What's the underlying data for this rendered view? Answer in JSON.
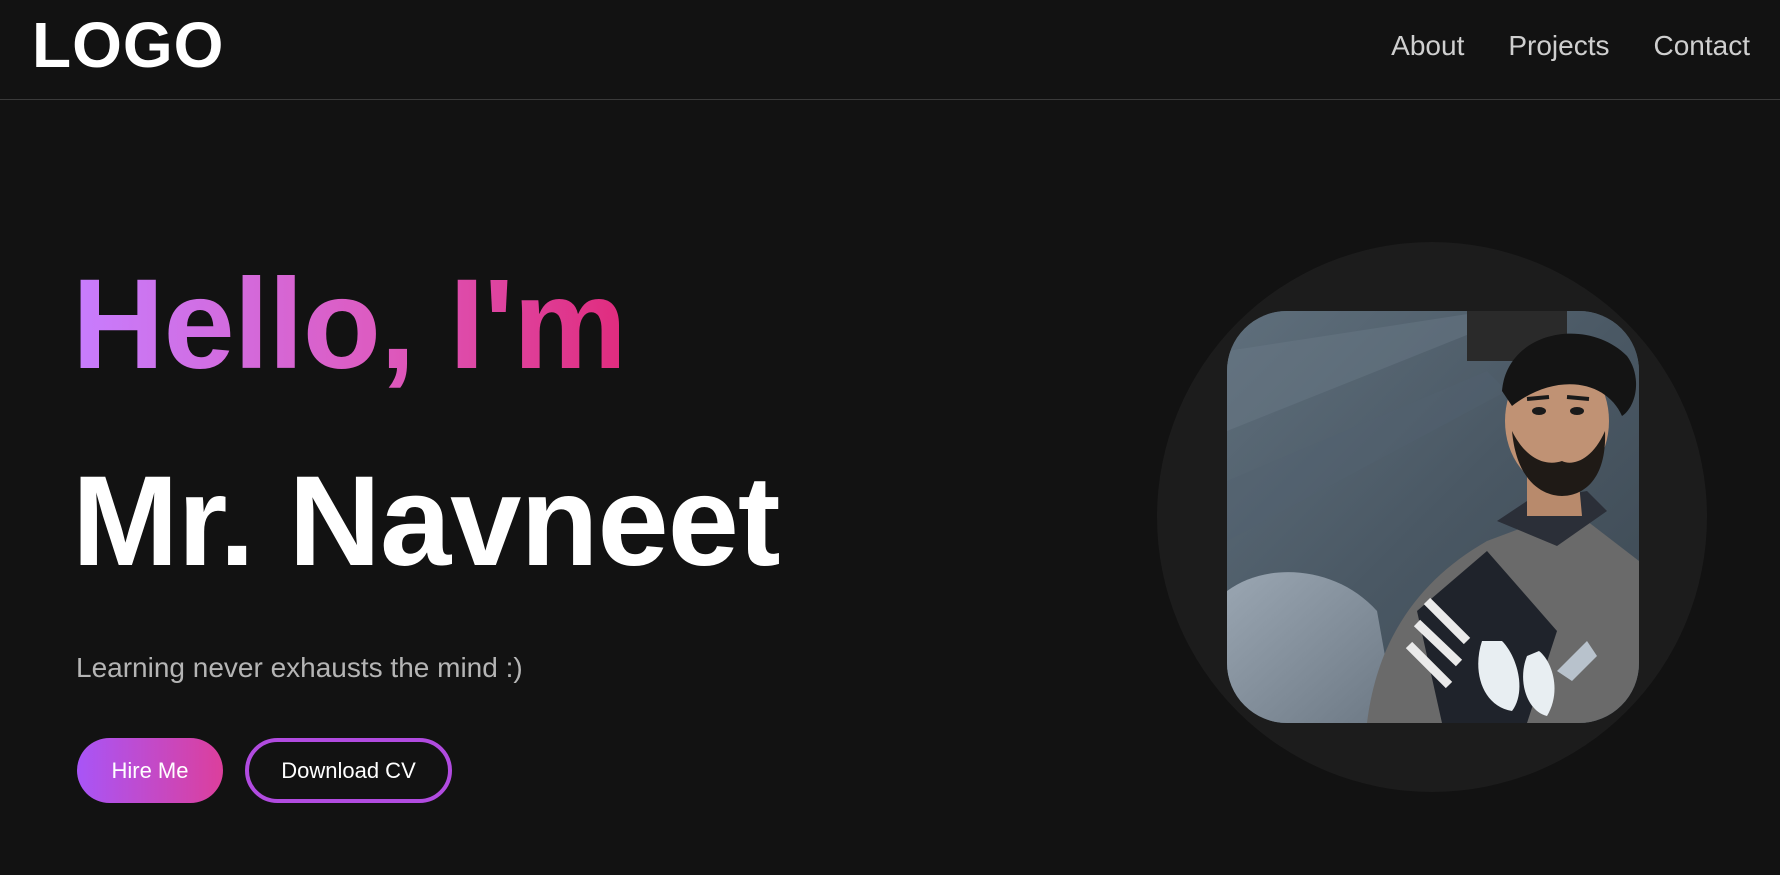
{
  "header": {
    "logo": "LOGO",
    "nav": [
      {
        "label": "About"
      },
      {
        "label": "Projects"
      },
      {
        "label": "Contact"
      }
    ]
  },
  "hero": {
    "greeting": "Hello, I'm",
    "name": "Mr. Navneet",
    "tagline": "Learning never exhausts the mind :)",
    "buttons": {
      "hire": "Hire Me",
      "cv": "Download CV"
    }
  },
  "colors": {
    "background": "#121212",
    "gradient_start": "#c77dff",
    "gradient_end": "#e02b7d",
    "accent_border": "#b14be0"
  }
}
